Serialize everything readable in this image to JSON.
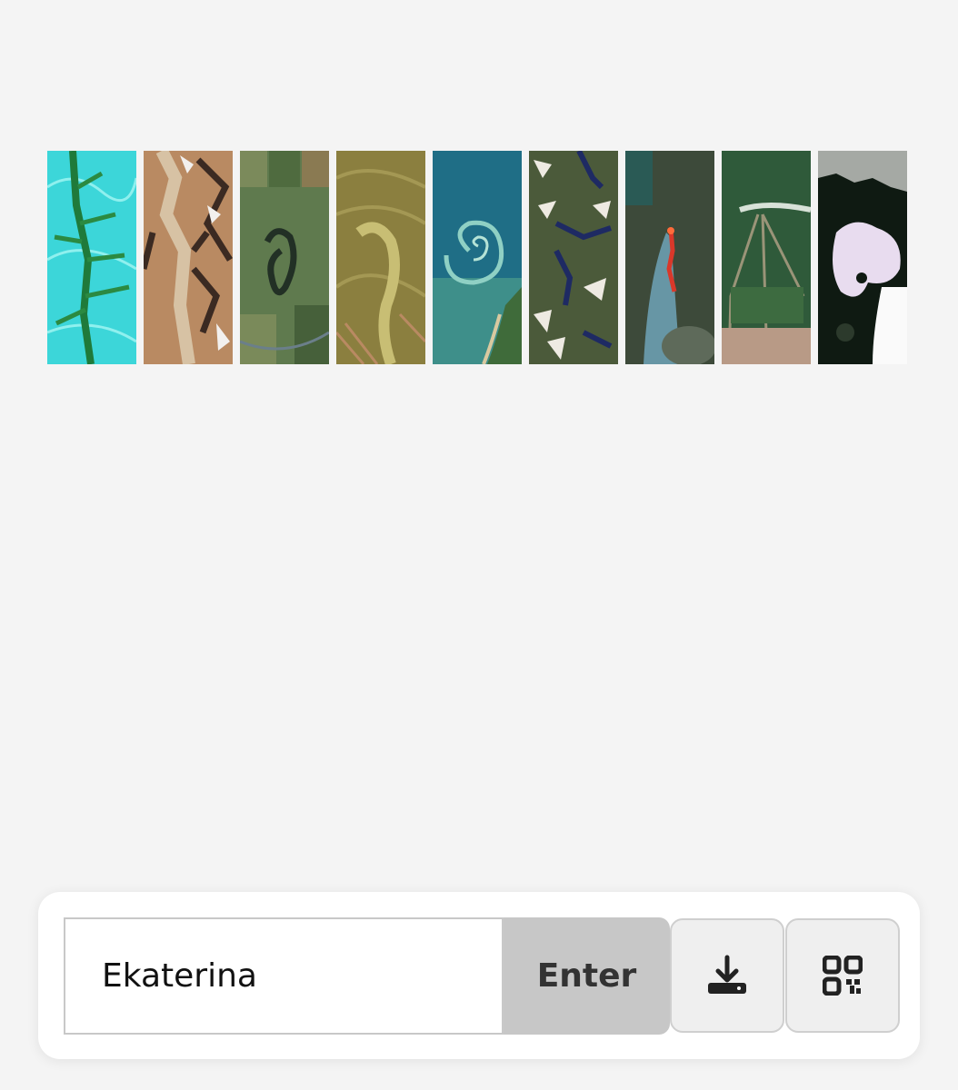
{
  "gallery": {
    "tiles": [
      {
        "name": "satellite-tile-cyan-valley",
        "colors": [
          "#3cd6d9",
          "#1f7a3a"
        ]
      },
      {
        "name": "satellite-tile-mountain-ridges",
        "colors": [
          "#b98a62",
          "#3b2a22"
        ]
      },
      {
        "name": "satellite-tile-farm-fields",
        "colors": [
          "#5f7a4e",
          "#2e3f2a"
        ]
      },
      {
        "name": "satellite-tile-olive-delta",
        "colors": [
          "#8b7f3f",
          "#c8be74"
        ]
      },
      {
        "name": "satellite-tile-ocean-swirl",
        "colors": [
          "#1f6e86",
          "#5fb5b3"
        ]
      },
      {
        "name": "satellite-tile-snowy-lakes",
        "colors": [
          "#4b5a3a",
          "#1e2a63"
        ]
      },
      {
        "name": "satellite-tile-wildfire-smoke",
        "colors": [
          "#3d4a3a",
          "#6fa3b8"
        ]
      },
      {
        "name": "satellite-tile-forest-clearing",
        "colors": [
          "#2f5a3a",
          "#b89a86"
        ]
      },
      {
        "name": "satellite-tile-frozen-forest",
        "colors": [
          "#0f1a12",
          "#e8dcef"
        ]
      }
    ]
  },
  "controls": {
    "name_value": "Ekaterina",
    "enter_label": "Enter",
    "download_icon": "download-icon",
    "qr_icon": "qr-code-icon"
  }
}
